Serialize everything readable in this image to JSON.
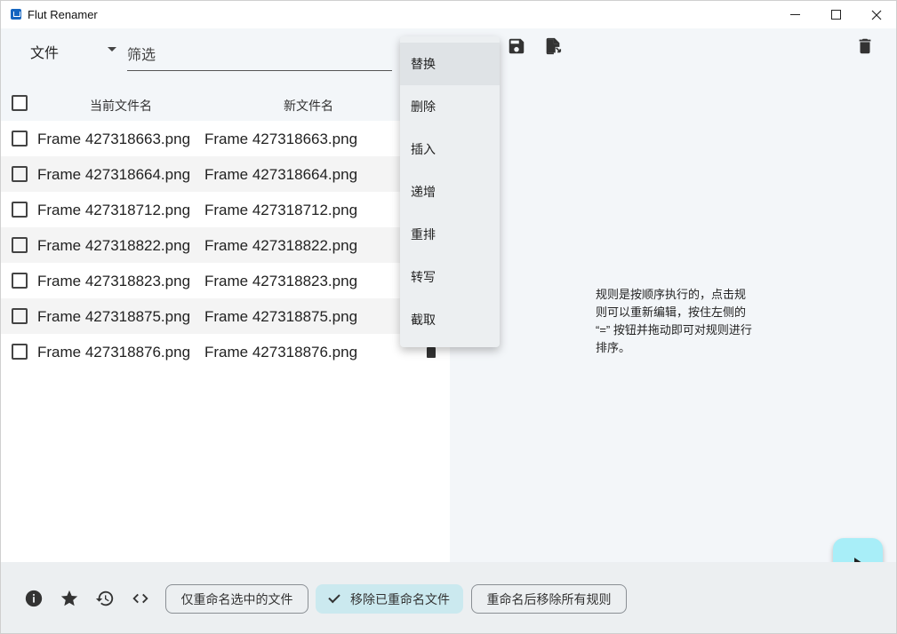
{
  "window": {
    "title": "Flut Renamer"
  },
  "toolbar": {
    "type_selector": "文件",
    "filter_placeholder": "筛选"
  },
  "file_table": {
    "headers": {
      "current_name": "当前文件名",
      "new_name": "新文件名"
    },
    "rows": [
      {
        "current": "Frame 427318663.png",
        "new": "Frame 427318663.png"
      },
      {
        "current": "Frame 427318664.png",
        "new": "Frame 427318664.png"
      },
      {
        "current": "Frame 427318712.png",
        "new": "Frame 427318712.png"
      },
      {
        "current": "Frame 427318822.png",
        "new": "Frame 427318822.png"
      },
      {
        "current": "Frame 427318823.png",
        "new": "Frame 427318823.png"
      },
      {
        "current": "Frame 427318875.png",
        "new": "Frame 427318875.png"
      },
      {
        "current": "Frame 427318876.png",
        "new": "Frame 427318876.png"
      }
    ]
  },
  "add_rule_menu": {
    "items": [
      "替换",
      "删除",
      "插入",
      "递增",
      "重排",
      "转写",
      "截取"
    ],
    "highlighted": "替换"
  },
  "rules_panel": {
    "hint": "规则是按顺序执行的，点击规则可以重新编辑，按住左侧的 “=” 按钮并拖动即可对规则进行排序。"
  },
  "bottom_bar": {
    "chips": {
      "rename_selected_only": "仅重命名选中的文件",
      "remove_renamed": "移除已重命名文件",
      "remove_rules_after": "重命名后移除所有规则"
    },
    "remove_renamed_selected": true
  },
  "colors": {
    "panel_bg": "#f3f6f9",
    "bottom_bg": "#eceff1",
    "fab_bg": "#a8eef8",
    "selected_chip": "#cbe9ef",
    "row_alt": "#f4f4f4"
  },
  "icons": {
    "save": "save-icon",
    "export": "file-export-icon",
    "delete_all": "trash-icon",
    "run": "play-icon",
    "info": "info-icon",
    "favorite": "star-icon",
    "history": "history-icon",
    "code": "code-icon"
  }
}
